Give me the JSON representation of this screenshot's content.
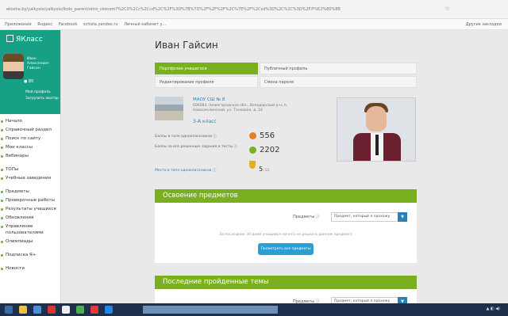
{
  "browser": {
    "url": "ekoshe.by/yalkyolo/yalkyolo/lkolo_parent/otiro_ckonom?%2C0%2Cc%2Ccd%2C%2F%3D%7B%7D%2F%2F%2F%2C%7E%2F%2Csd%3D%2C%2C%3D%2F.P%E2%80%8B",
    "bookmarks": [
      "Приложения",
      "Яндекс",
      "Facebook",
      "schizia.yandex.ru",
      "Личный кабинет у..."
    ],
    "bookmarks_right": "Другие закладки"
  },
  "sidebar": {
    "logo": "ЯКласс",
    "user_name": "Иван Алексеевич Гайсин",
    "user_points": "85",
    "links": [
      "Мой профиль",
      "Загрузить аватар"
    ],
    "nav": [
      "Начало",
      "Справочный раздел",
      "Поиск по сайту",
      "Мои классы",
      "Вебинары",
      "ТОПы",
      "Учебные заведения",
      "Предметы",
      "Проверочные работы",
      "Результаты учащихся",
      "Обновления",
      "Управление пользователями",
      "Олимпиады",
      "Подписка Я+",
      "Новости"
    ]
  },
  "page": {
    "title": "Иван Гайсин",
    "tabs": [
      "Портфолио учащегося",
      "Публичный профиль",
      "Редактирование профиля",
      "Смена пароля"
    ]
  },
  "school": {
    "name": "МАОУ СШ № 8",
    "address": "606084, Нижегородская обл., Володарский р-н, п. Новосмолинский, ул. Танковая, д. 24",
    "class": "3-А класс"
  },
  "stats": {
    "points_label": "Баллы в топе одноклассников",
    "points_value": "556",
    "tasks_label": "Баллы за все решенные задания и тесты",
    "tasks_value": "2202",
    "rank_link": "Место в топе одноклассников",
    "rank_value": "5",
    "rank_total": "/ 22"
  },
  "section1": {
    "title": "Освоение предметов",
    "filter_label": "Предметы",
    "select_value": "Предмет, который я прохожу",
    "note": "За последние 30 дней учащийся ничего не решал в данном предмете",
    "button": "Посмотреть все предметы"
  },
  "section2": {
    "title": "Последние пройденные темы",
    "filter_label": "Предметы",
    "select_value": "Предмет, который я прохожу"
  },
  "colors": {
    "sidebar_green": "#16a085",
    "accent_green": "#7ab020",
    "link_blue": "#2a7fb8",
    "button_blue": "#2a9fd6",
    "taskbar": "#1d2f4a"
  }
}
